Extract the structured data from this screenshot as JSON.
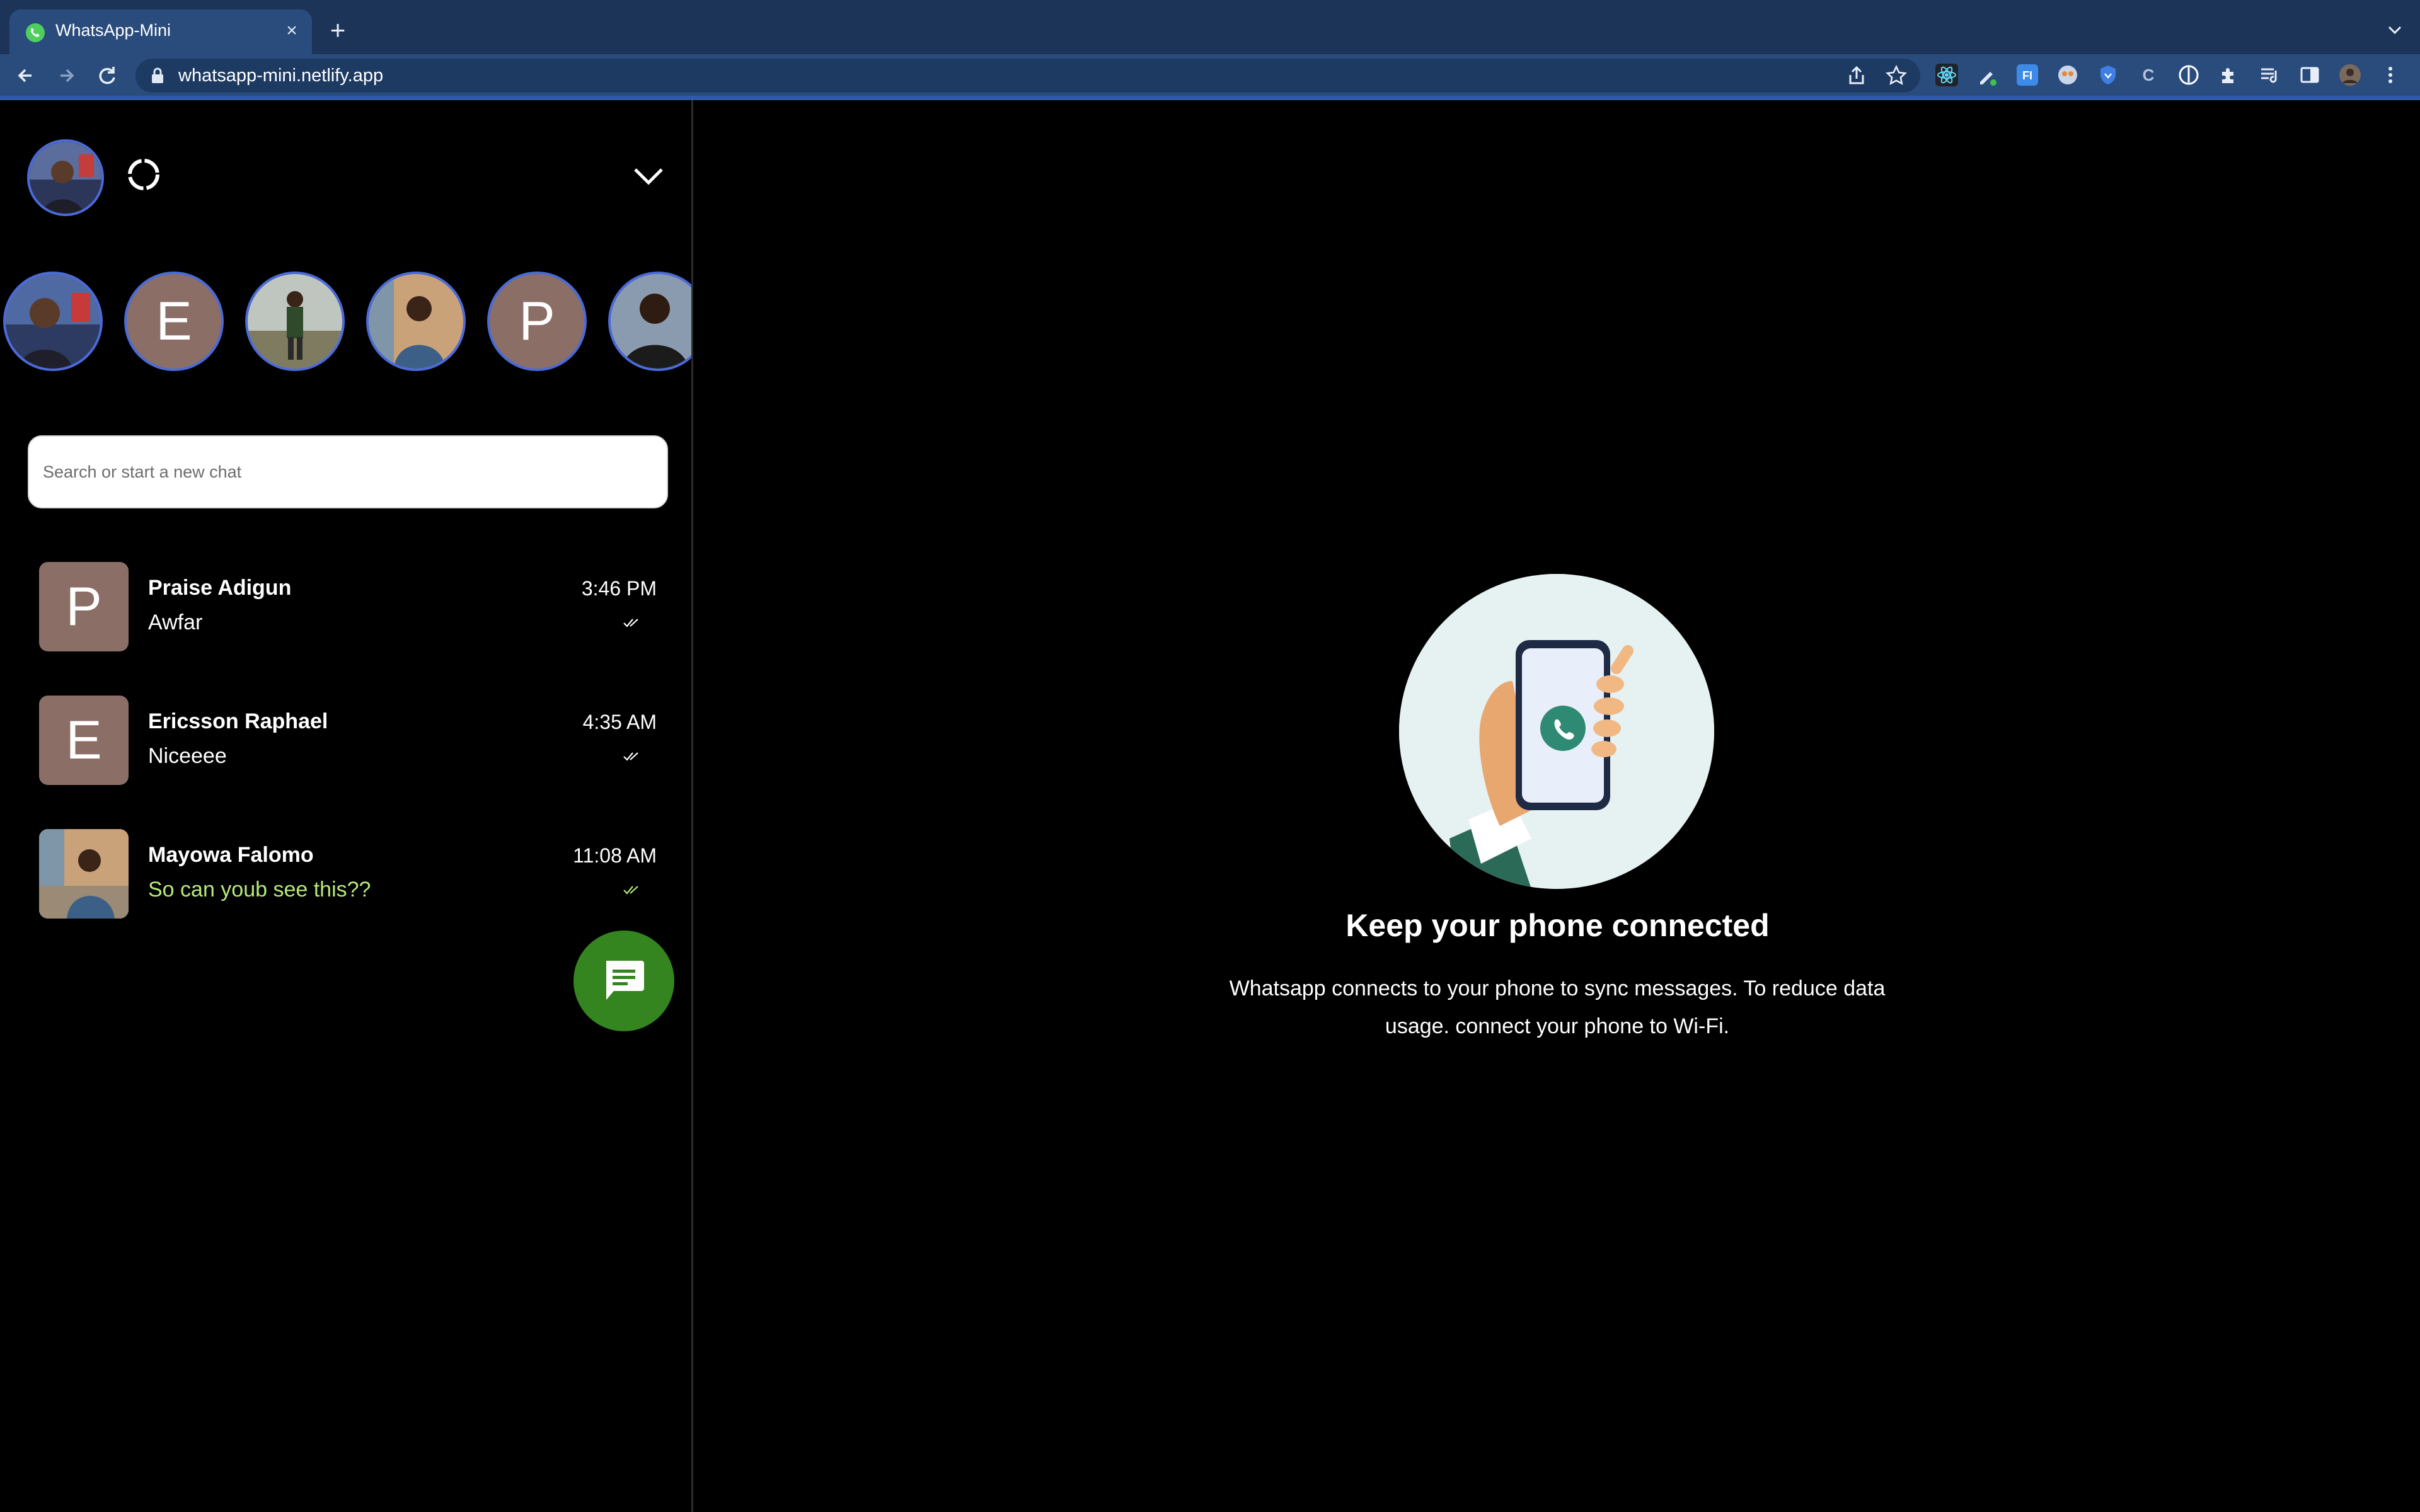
{
  "browser": {
    "tab_title": "WhatsApp-Mini",
    "url": "whatsapp-mini.netlify.app",
    "colors": {
      "tabstrip": "#1b3457",
      "toolbar": "#2a4c7d",
      "accent": "#2f5aa8"
    }
  },
  "sidebar": {
    "stories": [
      {
        "type": "photo",
        "label": ""
      },
      {
        "type": "letter",
        "label": "E"
      },
      {
        "type": "photo",
        "label": ""
      },
      {
        "type": "photo",
        "label": ""
      },
      {
        "type": "letter",
        "label": "P"
      },
      {
        "type": "photo",
        "label": ""
      }
    ],
    "search_placeholder": "Search or start a new chat",
    "chats": [
      {
        "name": "Praise Adigun",
        "message": "Awfar",
        "time": "3:46 PM",
        "avatar_letter": "P",
        "unread": false
      },
      {
        "name": "Ericsson Raphael",
        "message": "Niceeee",
        "time": "4:35 AM",
        "avatar_letter": "E",
        "unread": false
      },
      {
        "name": "Mayowa Falomo",
        "message": "So can youb see this??",
        "time": "11:08 AM",
        "avatar_letter": "",
        "unread": true
      }
    ]
  },
  "main": {
    "headline": "Keep your phone connected",
    "description": "Whatsapp connects to your phone to sync messages. To reduce data usage. connect your phone to Wi-Fi."
  },
  "colors": {
    "fab": "#34851f",
    "unread_message": "#b7ea7a",
    "avatar_ring": "#4a6ad8",
    "letter_avatar_bg": "#8b6e66",
    "illustration_bg": "#e6f1f1"
  }
}
